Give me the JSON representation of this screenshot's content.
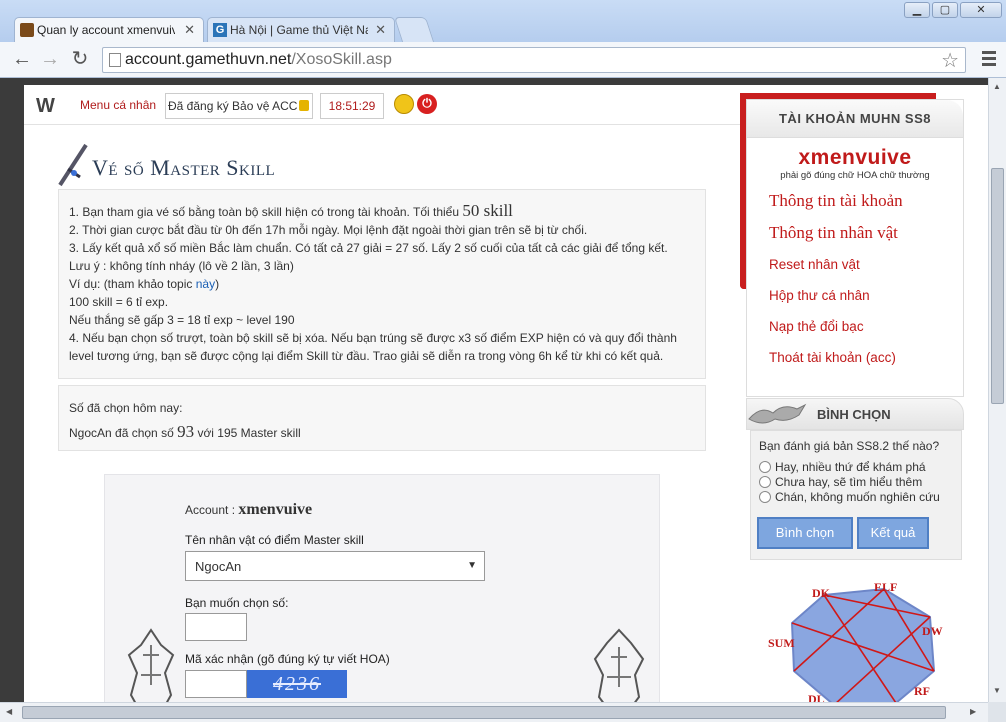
{
  "browser": {
    "tabs": [
      {
        "label": "Quan ly account xmenvuive",
        "active": true
      },
      {
        "label": "Hà Nội | Game thủ Việt Nam",
        "active": false
      }
    ],
    "url_host": "account.gamethuvn.net",
    "url_path": "/XosoSkill.asp"
  },
  "topbar": {
    "logo": "W",
    "menu_label": "Menu cá nhân",
    "registration": "Đã đăng ký Bảo vệ ACC",
    "clock": "18:51:29"
  },
  "main": {
    "title": "Vé số Master Skill",
    "rules": {
      "r1_prefix": "1. Bạn tham gia vé số bằng toàn bộ skill hiện có trong tài khoản. Tối thiểu",
      "r1_big": "50 skill",
      "r2": "2. Thời gian cược bắt đầu từ 0h đến 17h mỗi ngày. Mọi lệnh đặt ngoài thời gian trên sẽ bị từ chối.",
      "r3": "3. Lấy kết quả xổ số miền Bắc làm chuẩn. Có tất cả 27 giải = 27 số. Lấy 2 số cuối của tất cả các giải để tổng kết.",
      "note": "Lưu ý : không tính nháy (lô về 2 lần, 3 lần)",
      "example_prefix": "Ví dụ: (tham khảo topic",
      "example_link": "này",
      "example_suffix": ")",
      "ex1": "100 skill = 6 tỉ exp.",
      "ex2": "Nếu thắng sẽ gấp 3 = 18 tỉ exp ~ level 190",
      "r4": "4. Nếu bạn chọn số trượt, toàn bộ skill sẽ bị xóa. Nếu bạn trúng sẽ được x3 số điểm EXP hiện có và quy đổi thành level tương ứng, bạn sẽ được cộng lại điểm Skill từ đầu. Trao giải sẽ diễn ra trong vòng 6h kể từ khi có kết quả."
    },
    "chosen": {
      "heading": "Số đã chọn hôm nay:",
      "line_prefix": "NgocAn đã chọn số",
      "number": "93",
      "line_suffix": "với 195 Master skill"
    },
    "form": {
      "account_label": "Account :",
      "account_value": "xmenvuive",
      "char_label": "Tên nhân vật có điểm Master skill",
      "char_value": "NgocAn",
      "number_label": "Bạn muốn chọn số:",
      "captcha_label": "Mã xác nhận (gõ đúng ký tự viết HOA)",
      "captcha_text": "4236"
    }
  },
  "sidebar": {
    "account_title": "TÀI KHOẢN MUHN SS8",
    "username": "xmenvuive",
    "note": "phải gõ đúng chữ HOA chữ thường",
    "links_serif": [
      "Thông tin tài khoản",
      "Thông tin nhân vật"
    ],
    "links_sans": [
      "Reset nhân vật",
      "Hộp thư cá nhân",
      "Nạp thẻ đổi bạc",
      "Thoát tài khoản (acc)"
    ],
    "vote_title": "BÌNH CHỌN",
    "vote_question": "Bạn đánh giá bản SS8.2 thế nào?",
    "vote_options": [
      "Hay, nhiều thứ để khám phá",
      "Chưa hay, sẽ tìm hiểu thêm",
      "Chán, không muốn nghiên cứu"
    ],
    "vote_button": "Bình chọn",
    "result_button": "Kết quả",
    "class_labels": [
      "DK",
      "ELF",
      "DW",
      "RF",
      "SUM",
      "DL"
    ]
  },
  "colors": {
    "accent_red": "#c01a1a",
    "vote_button": "#7ea6df"
  }
}
